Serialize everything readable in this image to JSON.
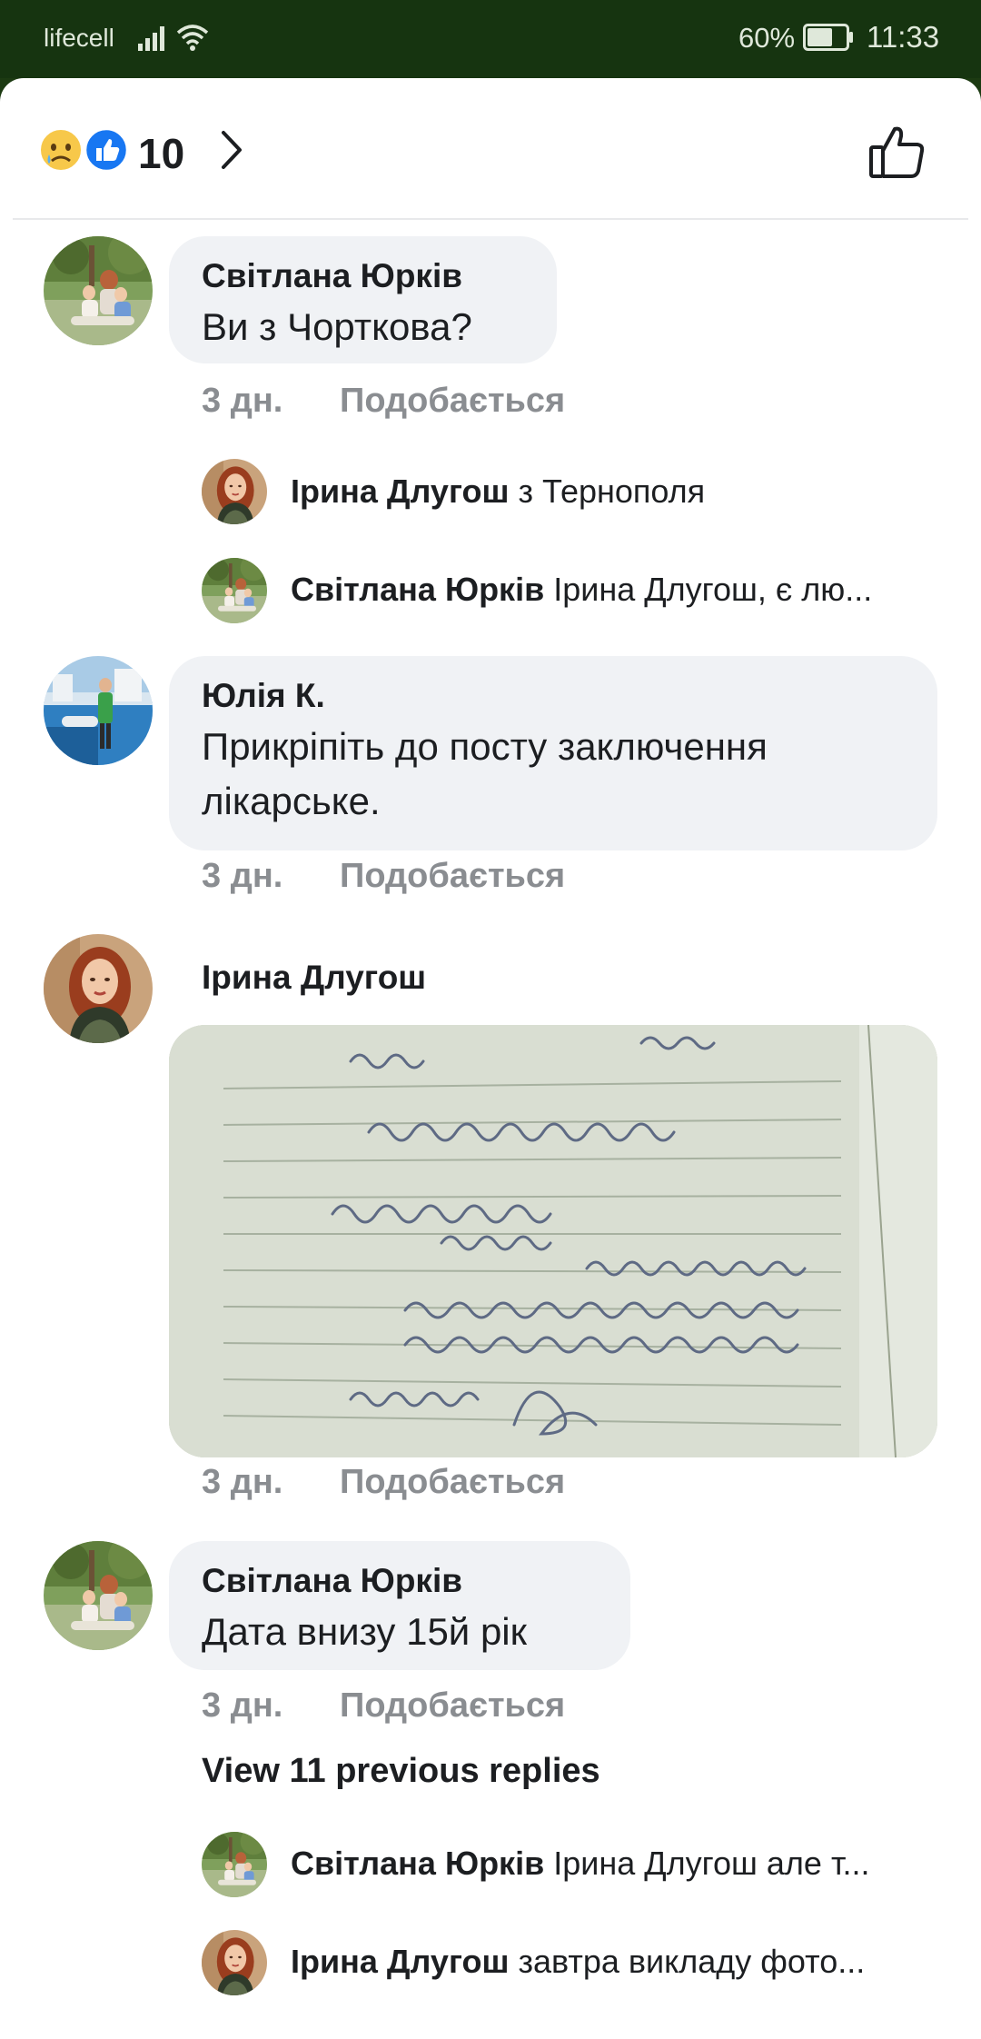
{
  "status_bar": {
    "carrier": "lifecell",
    "battery": "60%",
    "time": "11:33"
  },
  "reactions": {
    "count": "10",
    "icons": [
      "sad-face-icon",
      "like-icon"
    ]
  },
  "comments": [
    {
      "author": "Світлана Юрків",
      "text": "Ви з Чорткова?",
      "age": "3 дн.",
      "like_label": "Подобається",
      "replies": [
        {
          "author": "Ірина Длугош",
          "text": "з Тернополя"
        },
        {
          "author": "Світлана Юрків",
          "text": "Ірина Длугош, є лю..."
        }
      ]
    },
    {
      "author": "Юлія К.",
      "text": "Прикріпіть до посту заключення лікарське.",
      "age": "3 дн.",
      "like_label": "Подобається"
    },
    {
      "author": "Ірина Длугош",
      "attachment": "handwritten-medical-document-photo",
      "age": "3 дн.",
      "like_label": "Подобається"
    },
    {
      "author": "Світлана Юрків",
      "text": "Дата внизу 15й рік",
      "age": "3 дн.",
      "like_label": "Подобається",
      "view_previous": "View 11 previous replies",
      "replies": [
        {
          "author": "Світлана Юрків",
          "text": "Ірина Длугош але т..."
        },
        {
          "author": "Ірина Длугош",
          "text": "завтра викладу фото..."
        }
      ]
    }
  ],
  "colors": {
    "status_bar_bg": "#163410",
    "bubble_bg": "#f0f2f5",
    "meta_text": "#8a8d91",
    "like_blue": "#1877f2"
  }
}
